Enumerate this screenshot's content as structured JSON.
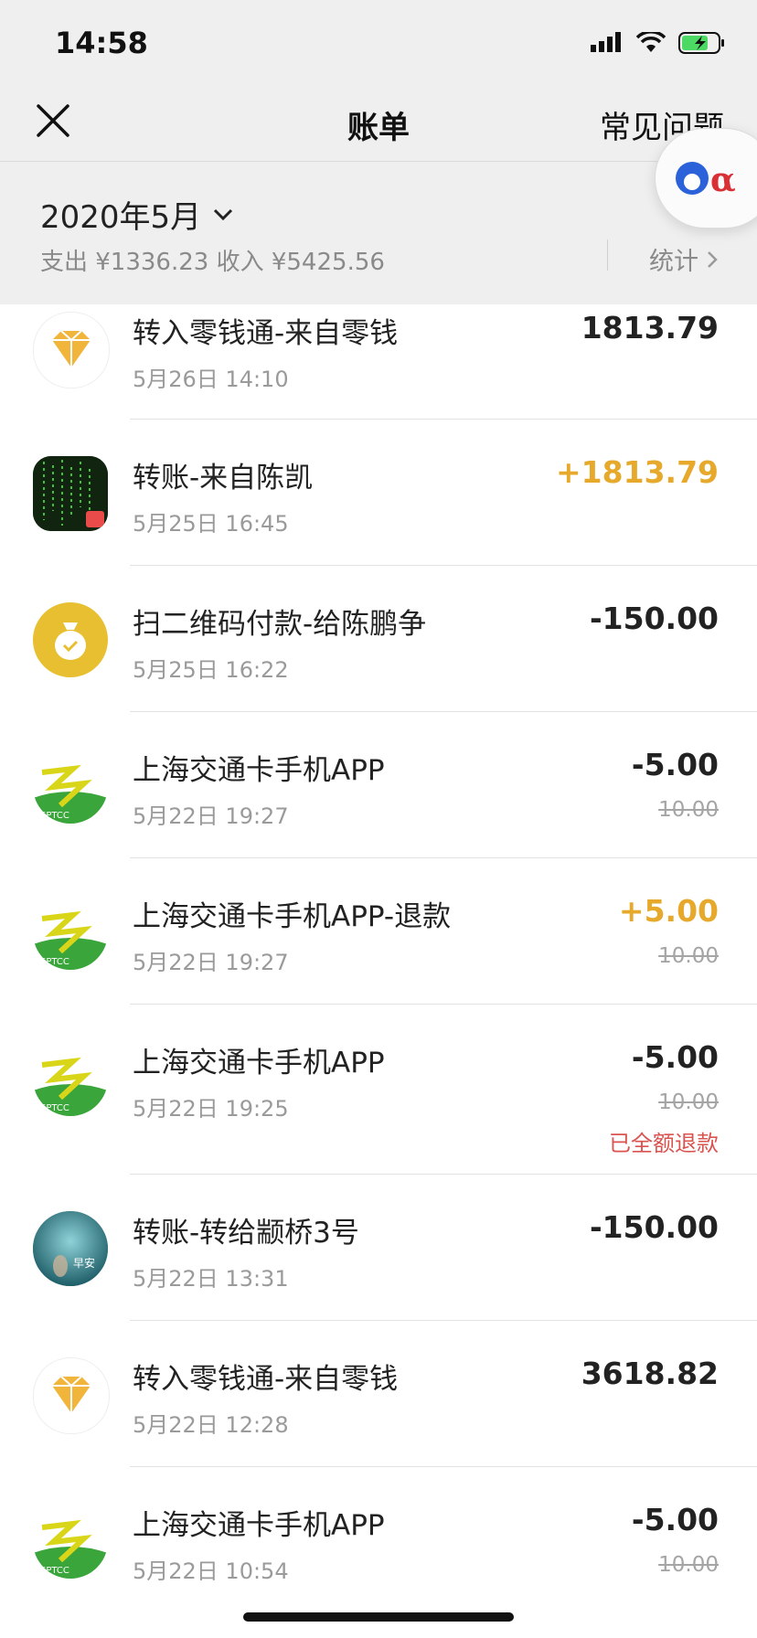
{
  "status_bar": {
    "time": "14:58"
  },
  "nav": {
    "title": "账单",
    "faq": "常见问题"
  },
  "filter": {
    "month": "2020年5月",
    "summary": "支出 ¥1336.23 收入 ¥5425.56",
    "stats": "统计"
  },
  "transactions": [
    {
      "title": "转入零钱通-来自零钱",
      "time": "5月26日 14:10",
      "amount": "1813.79",
      "icon": "diamond-icon"
    },
    {
      "title": "转账-来自陈凯",
      "time": "5月25日 16:45",
      "amount": "+1813.79",
      "icon": "contact-avatar-matrix"
    },
    {
      "title": "扫二维码付款-给陈鹏争",
      "time": "5月25日 16:22",
      "amount": "-150.00",
      "icon": "money-bag-icon"
    },
    {
      "title": "上海交通卡手机APP",
      "time": "5月22日 19:27",
      "amount": "-5.00",
      "original": "10.00",
      "icon": "sptcc-logo"
    },
    {
      "title": "上海交通卡手机APP-退款",
      "time": "5月22日 19:27",
      "amount": "+5.00",
      "original": "10.00",
      "icon": "sptcc-logo"
    },
    {
      "title": "上海交通卡手机APP",
      "time": "5月22日 19:25",
      "amount": "-5.00",
      "original": "10.00",
      "tag": "已全额退款",
      "icon": "sptcc-logo"
    },
    {
      "title": "转账-转给颛桥3号",
      "time": "5月22日 13:31",
      "amount": "-150.00",
      "icon": "contact-avatar-ocean",
      "avatar_text": "早安"
    },
    {
      "title": "转入零钱通-来自零钱",
      "time": "5月22日 12:28",
      "amount": "3618.82",
      "icon": "diamond-icon"
    },
    {
      "title": "上海交通卡手机APP",
      "time": "5月22日 10:54",
      "amount": "-5.00",
      "original": "10.00",
      "icon": "sptcc-logo"
    }
  ],
  "colors": {
    "income": "#e6a92b",
    "refund": "#d9534f",
    "header_bg": "#efefef"
  }
}
